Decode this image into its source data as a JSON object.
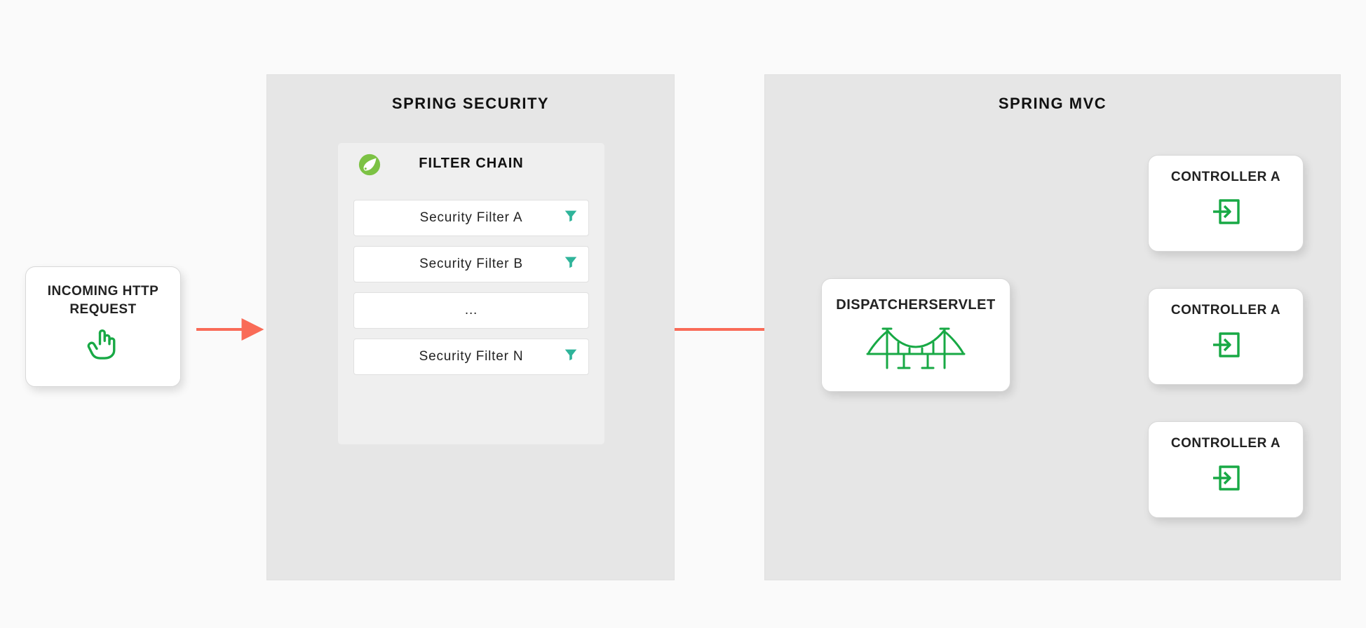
{
  "incoming": {
    "title1": "INCOMING HTTP",
    "title2": "REQUEST"
  },
  "security": {
    "panel_title": "SPRING SECURITY",
    "chain_title": "FILTER CHAIN",
    "filters": [
      "Security Filter A",
      "Security Filter B",
      "...",
      "Security Filter N"
    ]
  },
  "mvc": {
    "panel_title": "SPRING MVC",
    "dispatcher_title": "DISPATCHERSERVLET",
    "controllers": [
      "CONTROLLER A",
      "CONTROLLER A",
      "CONTROLLER A"
    ]
  },
  "colors": {
    "green": "#18A945",
    "arrow": "#f96b57",
    "teal": "#2fb49a"
  }
}
